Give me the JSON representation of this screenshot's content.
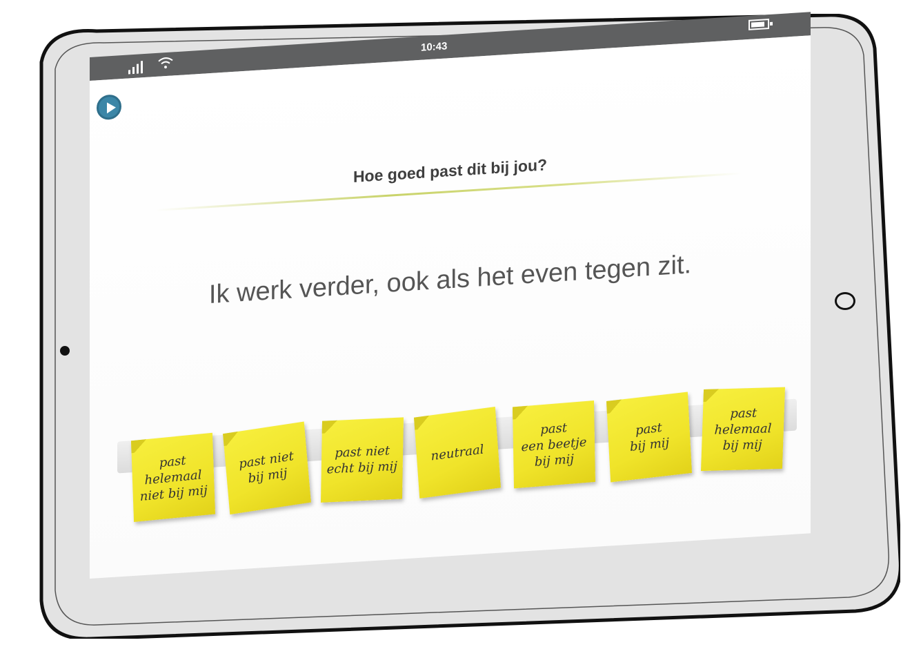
{
  "status_bar": {
    "time": "10:43",
    "signal_icon": "signal-bars-icon",
    "wifi_icon": "wifi-icon",
    "battery_icon": "battery-icon"
  },
  "play_icon": "play-icon",
  "question": {
    "title": "Hoe goed past dit bij jou?",
    "statement": "Ik werk verder, ook als het even tegen zit."
  },
  "answers": [
    "past\nhelemaal\nniet bij mij",
    "past niet\nbij mij",
    "past niet\necht bij mij",
    "neutraal",
    "past\neen beetje\nbij mij",
    "past\nbij mij",
    "past\nhelemaal\nbij mij"
  ],
  "colors": {
    "status_bar": "#5f6061",
    "sticky_note": "#f2e631",
    "play_button": "#3b86a7",
    "title_rule": "#c9d36a"
  }
}
